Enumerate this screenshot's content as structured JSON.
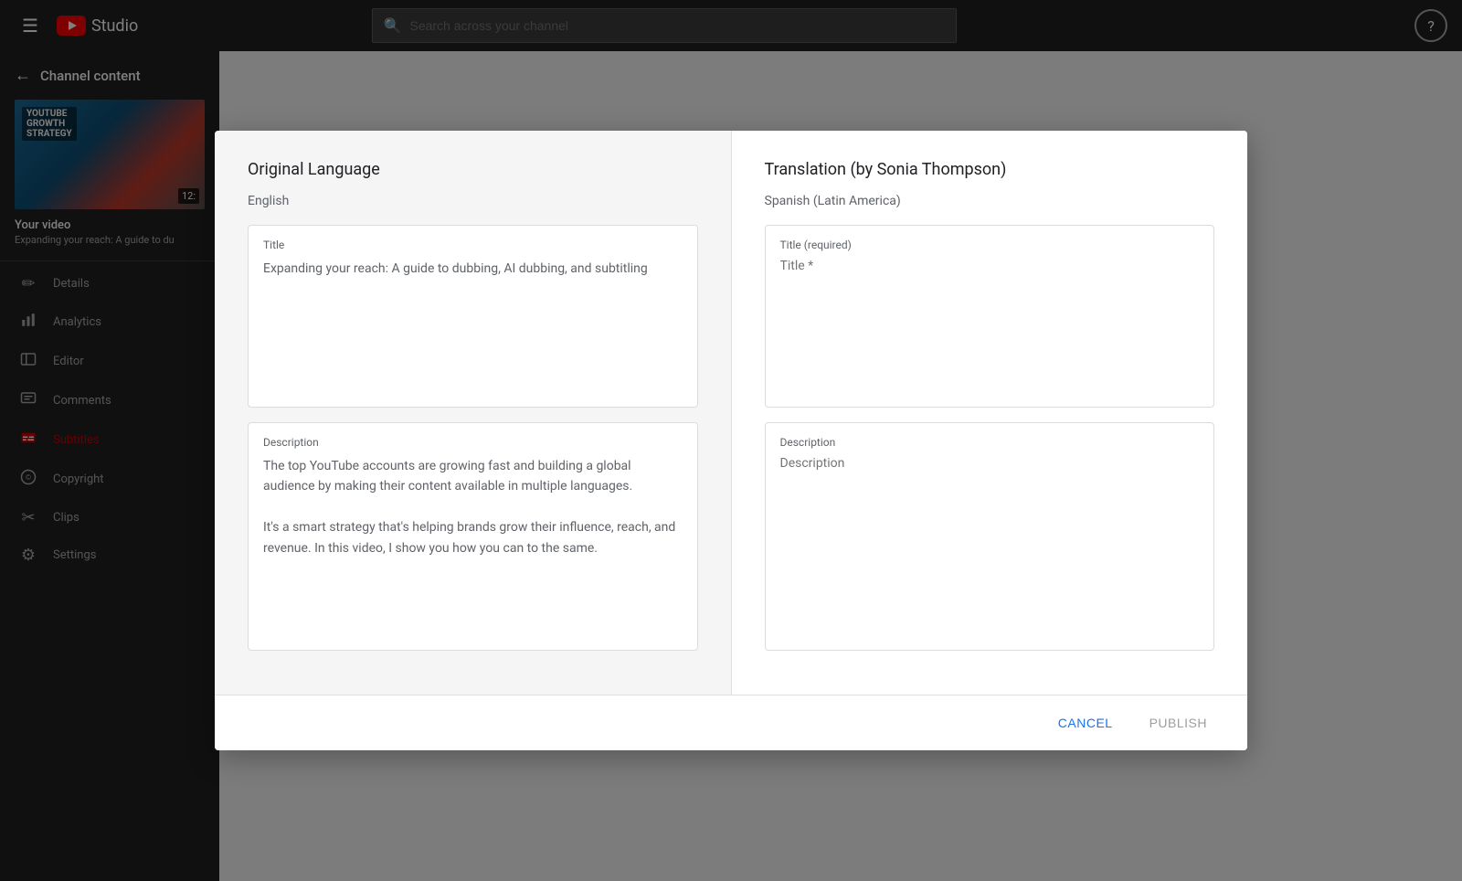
{
  "topbar": {
    "menu_icon": "☰",
    "studio_label": "Studio",
    "search_placeholder": "Search across your channel",
    "help_icon": "?"
  },
  "sidebar": {
    "back_label": "Channel content",
    "your_video_label": "Your video",
    "video_subtitle": "Expanding your reach: A guide to du",
    "thumb_overlay": "YouTube Growth Strategy",
    "thumb_duration": "12:",
    "items": [
      {
        "id": "details",
        "label": "Details",
        "icon": "✏"
      },
      {
        "id": "analytics",
        "label": "Analytics",
        "icon": "📊"
      },
      {
        "id": "editor",
        "label": "Editor",
        "icon": "⬛"
      },
      {
        "id": "comments",
        "label": "Comments",
        "icon": "☰"
      },
      {
        "id": "subtitles",
        "label": "Subtitles",
        "icon": "≡",
        "active": true
      },
      {
        "id": "copyright",
        "label": "Copyright",
        "icon": "©"
      },
      {
        "id": "clips",
        "label": "Clips",
        "icon": "✂"
      },
      {
        "id": "settings",
        "label": "Settings",
        "icon": "⚙"
      }
    ]
  },
  "modal": {
    "left_title": "Original Language",
    "left_lang": "English",
    "right_title": "Translation (by Sonia Thompson)",
    "right_lang": "Spanish (Latin America)",
    "title_label": "Title",
    "title_value": "Expanding your reach: A guide to dubbing, AI dubbing, and subtitling",
    "desc_label": "Description",
    "desc_value": "The top YouTube accounts are growing fast and building a global audience by making their content available in multiple languages.\n\nIt's a smart strategy that's helping brands grow their influence, reach, and revenue. In this video, I show you how you can to the same.",
    "right_title_label": "Title (required)",
    "right_title_placeholder": "Title *",
    "right_desc_label": "Description",
    "right_desc_placeholder": "Description",
    "cancel_label": "CANCEL",
    "publish_label": "PUBLISH"
  }
}
